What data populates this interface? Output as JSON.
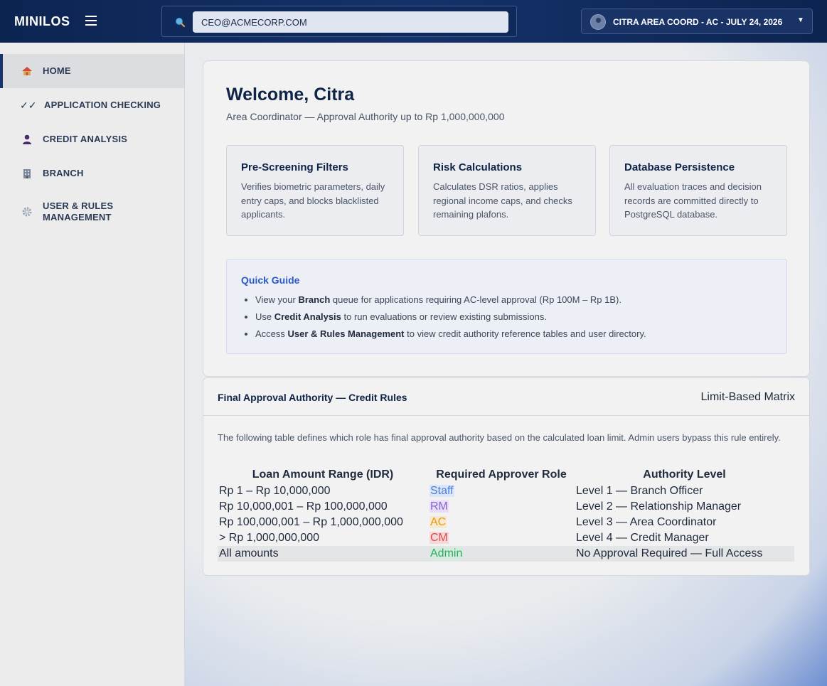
{
  "app": {
    "brand": "MINILOS",
    "search_value": "CEO@ACMECORP.COM",
    "user_label": "CITRA AREA COORD - AC - JULY 24, 2026"
  },
  "sidebar": {
    "items": [
      {
        "label": "HOME",
        "icon": "house-icon",
        "active": true
      },
      {
        "label": "APPLICATION CHECKING",
        "icon": "double-check-icon",
        "active": false
      },
      {
        "label": "CREDIT ANALYSIS",
        "icon": "person-icon",
        "active": false
      },
      {
        "label": "BRANCH",
        "icon": "building-icon",
        "active": false
      },
      {
        "label": "USER & RULES MANAGEMENT",
        "icon": "gear-icon",
        "active": false
      }
    ]
  },
  "welcome": {
    "title": "Welcome, Citra",
    "subtitle": "Area Coordinator — Approval Authority up to Rp 1,000,000,000"
  },
  "features": [
    {
      "title": "Pre-Screening Filters",
      "desc": "Verifies biometric parameters, daily entry caps, and blocks blacklisted applicants."
    },
    {
      "title": "Risk Calculations",
      "desc": "Calculates DSR ratios, applies regional income caps, and checks remaining plafons."
    },
    {
      "title": "Database Persistence",
      "desc": "All evaluation traces and decision records are committed directly to PostgreSQL database."
    }
  ],
  "guide": {
    "title": "Quick Guide",
    "items": [
      {
        "pre": "View your ",
        "bold": "Branch",
        "post": " queue for applications requiring AC-level approval (Rp 100M – Rp 1B)."
      },
      {
        "pre": "Use ",
        "bold": "Credit Analysis",
        "post": " to run evaluations or review existing submissions."
      },
      {
        "pre": "Access ",
        "bold": "User & Rules Management",
        "post": " to view credit authority reference tables and user directory."
      }
    ]
  },
  "rules": {
    "title": "Final Approval Authority — Credit Rules",
    "badge": "Limit-Based Matrix",
    "description": "The following table defines which role has final approval authority based on the calculated loan limit. Admin users bypass this rule entirely.",
    "headers": [
      "Loan Amount Range (IDR)",
      "Required Approver Role",
      "Authority Level"
    ],
    "rows": [
      {
        "range": "Rp 1 – Rp 10,000,000",
        "role": "Staff",
        "level": "Level 1 — Branch Officer",
        "role_color": "#4a7fd6",
        "role_bg": "#dce6f7"
      },
      {
        "range": "Rp 10,000,001 – Rp 100,000,000",
        "role": "RM",
        "level": "Level 2 — Relationship Manager",
        "role_color": "#8a63d2",
        "role_bg": "#e7def5"
      },
      {
        "range": "Rp 100,000,001 – Rp 1,000,000,000",
        "role": "AC",
        "level": "Level 3 — Area Coordinator",
        "role_color": "#e59a14",
        "role_bg": "#f7ead0"
      },
      {
        "range": "> Rp 1,000,000,000",
        "role": "CM",
        "level": "Level 4 — Credit Manager",
        "role_color": "#dd4a4a",
        "role_bg": "#f5d9d9"
      },
      {
        "range": "All amounts",
        "role": "Admin",
        "level": "No Approval Required — Full Access",
        "role_color": "#2faa6a",
        "role_bg": "#d3ecdc"
      }
    ]
  }
}
